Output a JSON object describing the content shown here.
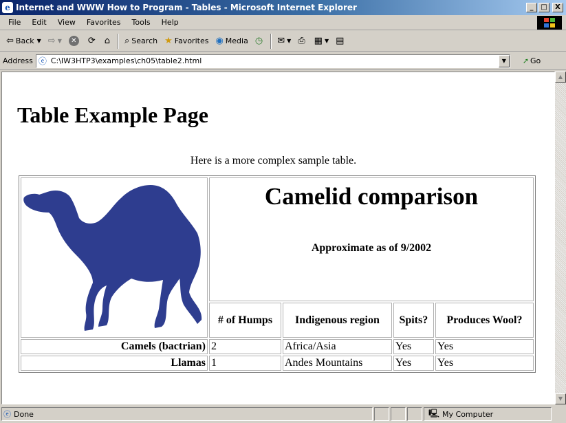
{
  "window": {
    "title": "Internet and WWW How to Program - Tables - Microsoft Internet Explorer",
    "minimize": "_",
    "maximize": "□",
    "close": "X"
  },
  "menu": [
    {
      "label": "File"
    },
    {
      "label": "Edit"
    },
    {
      "label": "View"
    },
    {
      "label": "Favorites"
    },
    {
      "label": "Tools"
    },
    {
      "label": "Help"
    }
  ],
  "toolbar": {
    "back": "Back",
    "search": "Search",
    "favorites": "Favorites",
    "media": "Media"
  },
  "address": {
    "label": "Address",
    "value": "C:\\IW3HTP3\\examples\\ch05\\table2.html",
    "go": "Go"
  },
  "page": {
    "heading": "Table Example Page",
    "intro": "Here is a more complex sample table.",
    "table": {
      "caption_title": "Camelid comparison",
      "caption_sub": "Approximate as of 9/2002",
      "headers": [
        "# of Humps",
        "Indigenous region",
        "Spits?",
        "Produces Wool?"
      ],
      "rows": [
        {
          "name": "Camels (bactrian)",
          "cells": [
            "2",
            "Africa/Asia",
            "Yes",
            "Yes"
          ]
        },
        {
          "name": "Llamas",
          "cells": [
            "1",
            "Andes Mountains",
            "Yes",
            "Yes"
          ]
        }
      ]
    },
    "camel_color": "#2e3d8f"
  },
  "status": {
    "text": "Done",
    "zone": "My Computer"
  }
}
